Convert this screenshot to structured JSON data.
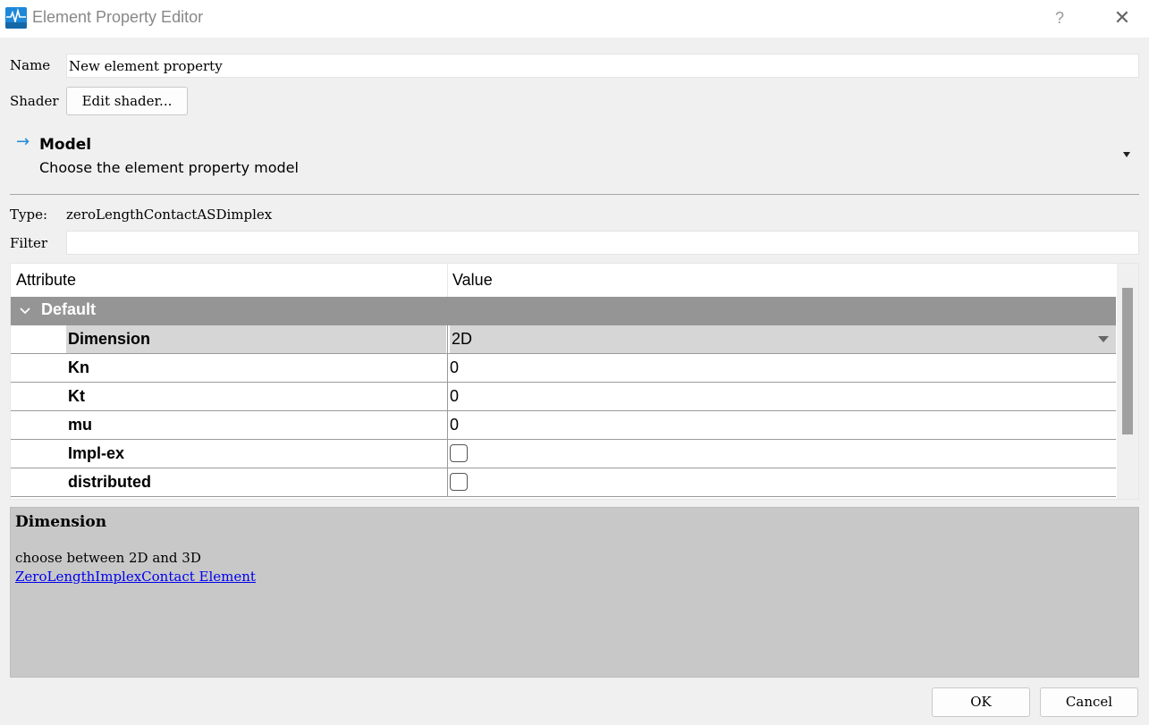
{
  "window": {
    "title": "Element Property Editor",
    "icon": "stko-app-icon",
    "help_label": "?",
    "close_label": "✕"
  },
  "form": {
    "name_label": "Name",
    "name_value": "New element property",
    "shader_label": "Shader",
    "shader_button": "Edit shader..."
  },
  "model_section": {
    "arrow": "→",
    "title": "Model",
    "subtitle": "Choose the element property model"
  },
  "type": {
    "label": "Type:",
    "value": "zeroLengthContactASDimplex"
  },
  "filter": {
    "label": "Filter",
    "value": ""
  },
  "table": {
    "headers": [
      "Attribute",
      "Value"
    ],
    "group": {
      "name": "Default",
      "expanded": true
    },
    "rows": [
      {
        "attr": "Dimension",
        "value": "2D",
        "kind": "dropdown",
        "selected": true
      },
      {
        "attr": "Kn",
        "value": "0",
        "kind": "text"
      },
      {
        "attr": "Kt",
        "value": "0",
        "kind": "text"
      },
      {
        "attr": "mu",
        "value": "0",
        "kind": "text"
      },
      {
        "attr": "Impl-ex",
        "value": "",
        "kind": "checkbox",
        "checked": false
      },
      {
        "attr": "distributed",
        "value": "",
        "kind": "checkbox",
        "checked": false
      }
    ]
  },
  "help_panel": {
    "title": "Dimension",
    "description": "choose between 2D and 3D",
    "link": "ZeroLengthImplexContact Element"
  },
  "buttons": {
    "ok": "OK",
    "cancel": "Cancel"
  },
  "colors": {
    "group_header": "#959595",
    "selected_row": "#d6d6d6",
    "help_bg": "#c8c8c8",
    "link": "#0000ee",
    "model_arrow": "#1e88d8"
  }
}
